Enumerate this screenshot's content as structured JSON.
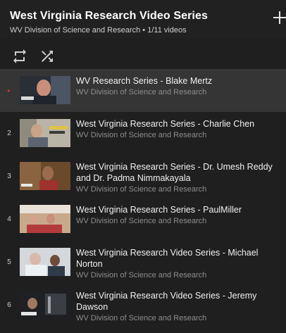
{
  "header": {
    "title": "West Virginia Research Video Series",
    "subtitle": "WV Division of Science and Research • 1/11 videos"
  },
  "controls": {
    "loop_icon": "loop-icon",
    "shuffle_icon": "shuffle-icon",
    "add_icon": "plus-icon"
  },
  "colors": {
    "background": "#1f1f1f",
    "active_row": "#353535",
    "now_playing_marker": "#d33a2c",
    "channel_text": "#8e8e8e"
  },
  "playlist": {
    "current_index": 1,
    "items": [
      {
        "index": "▸",
        "title": "WV Research Series - Blake Mertz",
        "channel": "WV Division of Science and Research"
      },
      {
        "index": "2",
        "title": "West Virginia Research Series - Charlie Chen",
        "channel": "WV Division of Science and Research"
      },
      {
        "index": "3",
        "title": "West Virginia Research Series - Dr. Umesh Reddy and Dr. Padma Nimmakayala",
        "channel": "WV Division of Science and Research"
      },
      {
        "index": "4",
        "title": "West Virginia Research Series - PaulMiller",
        "channel": "WV Division of Science and Research"
      },
      {
        "index": "5",
        "title": "West Virginia Research Video Series - Michael Norton",
        "channel": "WV Division of Science and Research"
      },
      {
        "index": "6",
        "title": "West Virginia Research Video Series - Jeremy Dawson",
        "channel": "WV Division of Science and Research"
      }
    ]
  }
}
